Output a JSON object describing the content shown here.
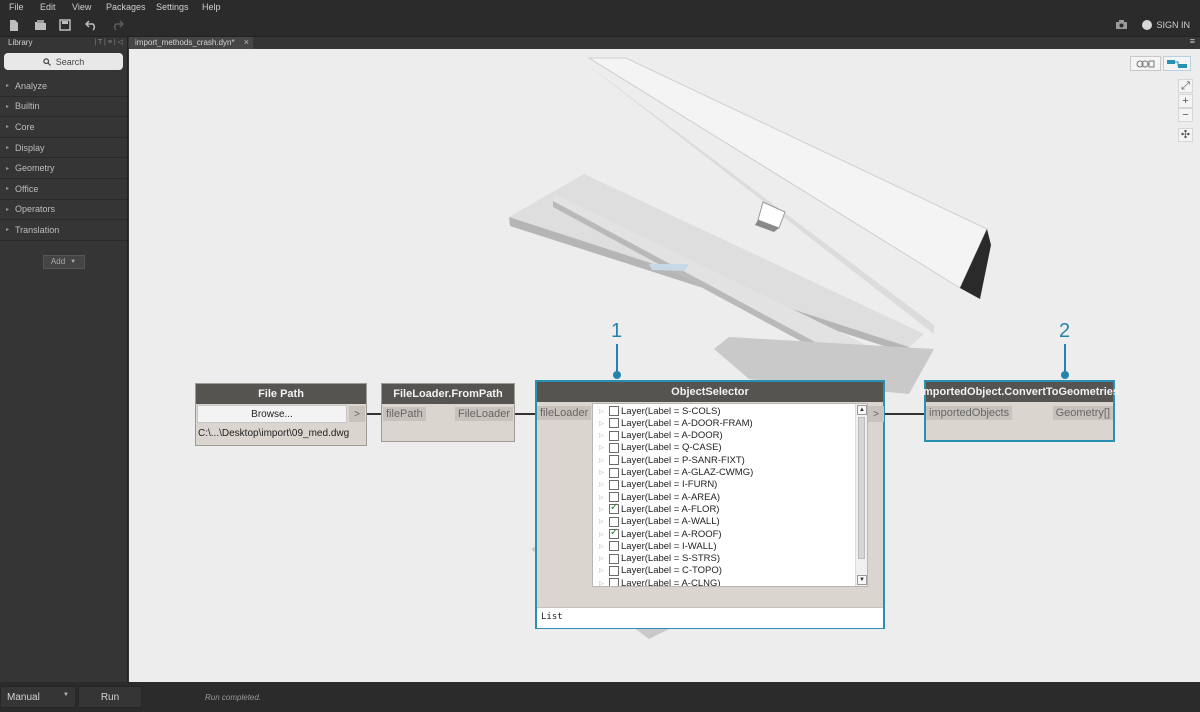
{
  "menubar": {
    "items": [
      "File",
      "Edit",
      "View",
      "Packages",
      "Settings",
      "Help"
    ]
  },
  "toolbar": {
    "icons": [
      "new-file-icon",
      "open-folder-icon",
      "save-icon",
      "undo-icon",
      "redo-icon"
    ],
    "camera_icon": "camera-icon",
    "signin_label": "SIGN IN"
  },
  "library": {
    "title": "Library",
    "search_placeholder": "Search",
    "categories": [
      "Analyze",
      "Builtin",
      "Core",
      "Display",
      "Geometry",
      "Office",
      "Operators",
      "Translation"
    ],
    "add_label": "Add"
  },
  "tabs": [
    {
      "label": "import_methods_crash.dyn*"
    }
  ],
  "nodes": {
    "file_path": {
      "title": "File Path",
      "browse_label": "Browse...",
      "path": "C:\\...\\Desktop\\import\\09_med.dwg",
      "out": ">"
    },
    "file_loader": {
      "title": "FileLoader.FromPath",
      "input": "filePath",
      "output": "FileLoader"
    },
    "object_selector": {
      "title": "ObjectSelector",
      "input": "fileLoader",
      "out": ">",
      "layers": [
        {
          "label": "Layer(Label = S-COLS)",
          "checked": false
        },
        {
          "label": "Layer(Label = A-DOOR-FRAM)",
          "checked": false
        },
        {
          "label": "Layer(Label = A-DOOR)",
          "checked": false
        },
        {
          "label": "Layer(Label = Q-CASE)",
          "checked": false
        },
        {
          "label": "Layer(Label = P-SANR-FIXT)",
          "checked": false
        },
        {
          "label": "Layer(Label = A-GLAZ-CWMG)",
          "checked": false
        },
        {
          "label": "Layer(Label = I-FURN)",
          "checked": false
        },
        {
          "label": "Layer(Label = A-AREA)",
          "checked": false
        },
        {
          "label": "Layer(Label = A-FLOR)",
          "checked": true
        },
        {
          "label": "Layer(Label = A-WALL)",
          "checked": false
        },
        {
          "label": "Layer(Label = A-ROOF)",
          "checked": true
        },
        {
          "label": "Layer(Label = I-WALL)",
          "checked": false
        },
        {
          "label": "Layer(Label = S-STRS)",
          "checked": false
        },
        {
          "label": "Layer(Label = C-TOPO)",
          "checked": false
        },
        {
          "label": "Layer(Label = A-CLNG)",
          "checked": false
        }
      ],
      "preview": "List"
    },
    "convert": {
      "title": "ImportedObject.ConvertToGeometries",
      "input": "importedObjects",
      "output": "Geometry[]"
    }
  },
  "callouts": [
    "1",
    "2"
  ],
  "statusbar": {
    "run_mode": "Manual",
    "run_label": "Run",
    "status": "Run completed."
  },
  "colors": {
    "accent": "#2583a9",
    "node_title": "#565450",
    "node_body": "#dad6cf"
  }
}
